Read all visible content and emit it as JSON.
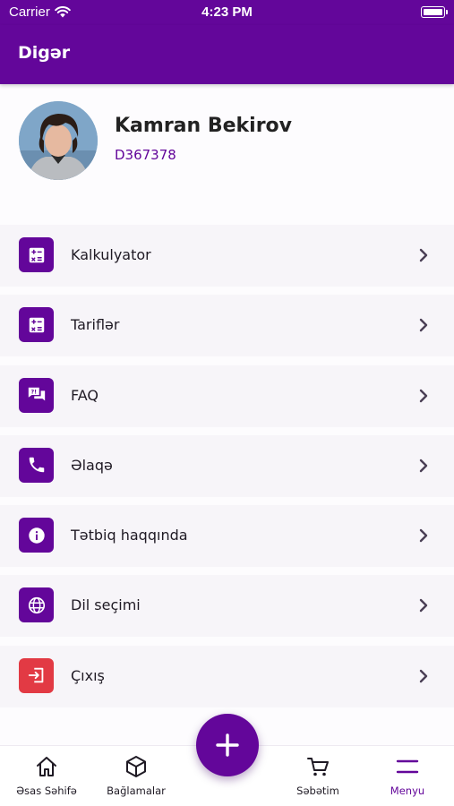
{
  "status_bar": {
    "carrier": "Carrier",
    "time": "4:23 PM"
  },
  "header": {
    "title": "Digər"
  },
  "profile": {
    "name": "Kamran Bekirov",
    "code": "D367378"
  },
  "menu": {
    "items": [
      {
        "label": "Kalkulyator",
        "icon": "calculator-icon"
      },
      {
        "label": "Tariflər",
        "icon": "calculator-icon"
      },
      {
        "label": "FAQ",
        "icon": "faq-icon"
      },
      {
        "label": "Əlaqə",
        "icon": "phone-icon"
      },
      {
        "label": "Tətbiq haqqında",
        "icon": "info-icon"
      },
      {
        "label": "Dil seçimi",
        "icon": "globe-icon"
      },
      {
        "label": "Çıxış",
        "icon": "logout-icon"
      }
    ]
  },
  "tab_bar": {
    "tabs": [
      {
        "label": "Əsas Səhifə",
        "icon": "home-icon"
      },
      {
        "label": "Bağlamalar",
        "icon": "package-icon"
      },
      {
        "label": "Səbətim",
        "icon": "cart-icon"
      },
      {
        "label": "Menyu",
        "icon": "menu-icon"
      }
    ],
    "active": "Menyu"
  },
  "colors": {
    "primary": "#63069a",
    "danger": "#e23a44"
  }
}
